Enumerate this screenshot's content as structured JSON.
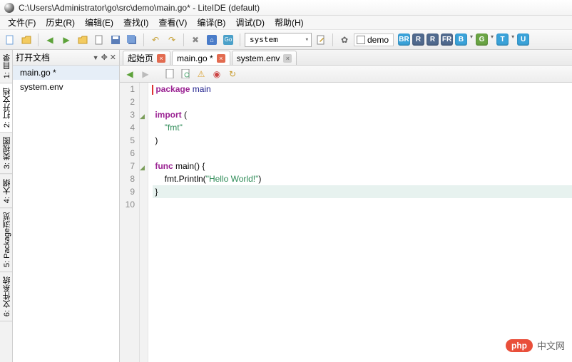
{
  "window": {
    "title": "C:\\Users\\Administrator\\go\\src\\demo\\main.go* - LiteIDE (default)"
  },
  "menu": {
    "file": "文件(F)",
    "history": "历史(R)",
    "edit": "编辑(E)",
    "find": "查找(I)",
    "view": "查看(V)",
    "build": "编译(B)",
    "debug": "调试(D)",
    "help": "帮助(H)"
  },
  "toolbar": {
    "combo1": "system",
    "demo_label": "demo",
    "badges": [
      "BR",
      "R",
      "R",
      "FR",
      "B",
      "G",
      "T",
      "U"
    ],
    "badge_colors": [
      "#3aa2d9",
      "#516a8e",
      "#516a8e",
      "#516a8e",
      "#3aa2d9",
      "#6aa444",
      "#3aa2d9",
      "#3aa2d9"
    ]
  },
  "vtabs": [
    "1: 目录",
    "2: 打开文档",
    "3: 类视图",
    "4: 大纲",
    "5: Package浏览",
    "6: 文件系统"
  ],
  "sidebar": {
    "title": "打开文档",
    "items": [
      "main.go *",
      "system.env"
    ]
  },
  "editor_tabs": [
    {
      "label": "起始页",
      "close": "red"
    },
    {
      "label": "main.go *",
      "close": "red",
      "active": true
    },
    {
      "label": "system.env",
      "close": "gray"
    }
  ],
  "code": {
    "lines": [
      {
        "n": 1,
        "html": "<span class='kw'>package</span> <span class='pkg'>main</span>",
        "cursor": true
      },
      {
        "n": 2,
        "html": ""
      },
      {
        "n": 3,
        "html": "<span class='kw'>import</span> (",
        "fold": true
      },
      {
        "n": 4,
        "html": "    <span class='str'>\"fmt\"</span>"
      },
      {
        "n": 5,
        "html": ")"
      },
      {
        "n": 6,
        "html": ""
      },
      {
        "n": 7,
        "html": "<span class='kw'>func</span> main() {",
        "fold": true
      },
      {
        "n": 8,
        "html": "    fmt.Println(<span class='str'>\"Hello World!\"</span>)"
      },
      {
        "n": 9,
        "html": "}",
        "highlight": true
      },
      {
        "n": 10,
        "html": ""
      }
    ]
  },
  "watermark": {
    "badge": "php",
    "text": "中文网"
  }
}
